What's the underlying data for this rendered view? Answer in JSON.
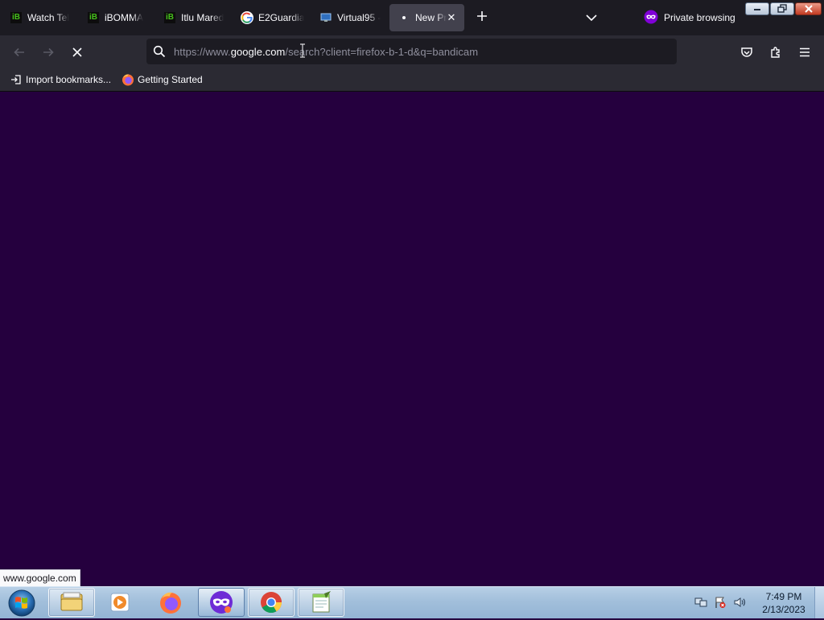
{
  "tabs": [
    {
      "label": "Watch Tel",
      "icon": "ibomma-icon",
      "active": false
    },
    {
      "label": "iBOMMA",
      "icon": "ibomma-icon",
      "active": false
    },
    {
      "label": "Itlu Mared",
      "icon": "ibomma-icon",
      "active": false
    },
    {
      "label": "E2Guardia",
      "icon": "google-icon",
      "active": false
    },
    {
      "label": "Virtual95 -",
      "icon": "monitor-icon",
      "active": false
    },
    {
      "label": "New Pr",
      "icon": "loading-dot-icon",
      "active": true
    }
  ],
  "private_browsing_label": "Private browsing",
  "url": {
    "prefix": "https://www.",
    "host": "google.com",
    "path": "/search?client=firefox-b-1-d&q=bandicam"
  },
  "bookmarks": [
    {
      "label": "Import bookmarks...",
      "icon": "import-icon"
    },
    {
      "label": "Getting Started",
      "icon": "firefox-icon"
    }
  ],
  "status_text": "www.google.com",
  "taskbar": {
    "items": [
      "file-explorer-icon",
      "media-player-icon",
      "firefox-icon",
      "firefox-private-icon",
      "chrome-icon",
      "notepad-icon"
    ]
  },
  "clock": {
    "time": "7:49 PM",
    "date": "2/13/2023"
  },
  "colors": {
    "content_background": "#25003e",
    "toolbar": "#2b2a33",
    "tabstrip": "#1c1b22",
    "private_accent": "#8000d7"
  }
}
